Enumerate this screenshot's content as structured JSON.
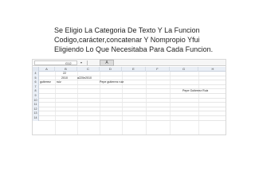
{
  "caption": {
    "lines": [
      "Se Eligio La Categoria De Texto Y La Funcion",
      "Codigo,carácter,concatenar Y Nompropio Yfui",
      "Eligiendo Lo Que Necesitaba Para Cada Funcion."
    ]
  },
  "spreadsheet": {
    "name_box": "G12",
    "name_box_dropdown": "▾",
    "formula_button": "A",
    "columns": [
      "A",
      "B",
      "C",
      "D",
      "E",
      "F",
      "G",
      "H"
    ],
    "rows": [
      {
        "num": "4",
        "cells": {
          "B": "22"
        }
      },
      {
        "num": "5",
        "cells": {
          "B": "2010",
          "C": "a220e2010"
        }
      },
      {
        "num": "6",
        "cells": {
          "A": "gutierrez",
          "B": "ruiz",
          "D": "Pepe gutierrez ruiz"
        }
      },
      {
        "num": "7",
        "cells": {}
      },
      {
        "num": "8",
        "cells": {
          "G": "Pepe Gutierrez Ruiz"
        }
      },
      {
        "num": "9",
        "cells": {}
      },
      {
        "num": "10",
        "cells": {}
      },
      {
        "num": "11",
        "cells": {}
      },
      {
        "num": "12",
        "cells": {}
      },
      {
        "num": "13",
        "cells": {}
      },
      {
        "num": "14",
        "cells": {}
      }
    ]
  }
}
